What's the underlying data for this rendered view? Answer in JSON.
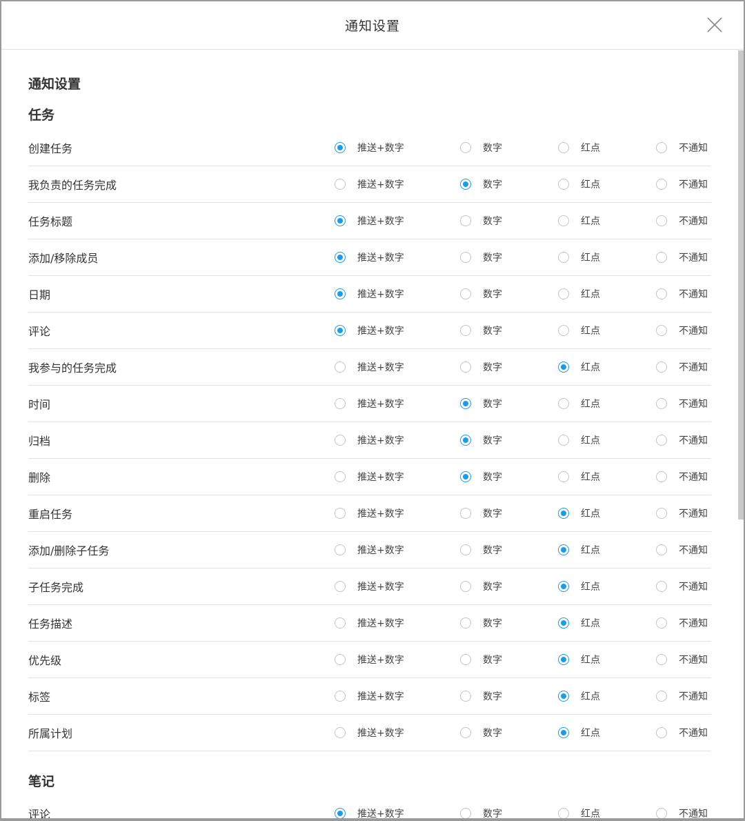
{
  "dialog": {
    "title": "通知设置",
    "page_heading": "通知设置"
  },
  "options": [
    "推送+数字",
    "数字",
    "红点",
    "不通知"
  ],
  "sections": [
    {
      "title": "任务",
      "rows": [
        {
          "label": "创建任务",
          "selected": 0
        },
        {
          "label": "我负责的任务完成",
          "selected": 1
        },
        {
          "label": "任务标题",
          "selected": 0
        },
        {
          "label": "添加/移除成员",
          "selected": 0
        },
        {
          "label": "日期",
          "selected": 0
        },
        {
          "label": "评论",
          "selected": 0
        },
        {
          "label": "我参与的任务完成",
          "selected": 2
        },
        {
          "label": "时间",
          "selected": 1
        },
        {
          "label": "归档",
          "selected": 1
        },
        {
          "label": "删除",
          "selected": 1
        },
        {
          "label": "重启任务",
          "selected": 2
        },
        {
          "label": "添加/删除子任务",
          "selected": 2
        },
        {
          "label": "子任务完成",
          "selected": 2
        },
        {
          "label": "任务描述",
          "selected": 2
        },
        {
          "label": "优先级",
          "selected": 2
        },
        {
          "label": "标签",
          "selected": 2
        },
        {
          "label": "所属计划",
          "selected": 2
        }
      ]
    },
    {
      "title": "笔记",
      "rows": [
        {
          "label": "评论",
          "selected": 0
        }
      ]
    }
  ],
  "colors": {
    "accent": "#1e9be8"
  }
}
